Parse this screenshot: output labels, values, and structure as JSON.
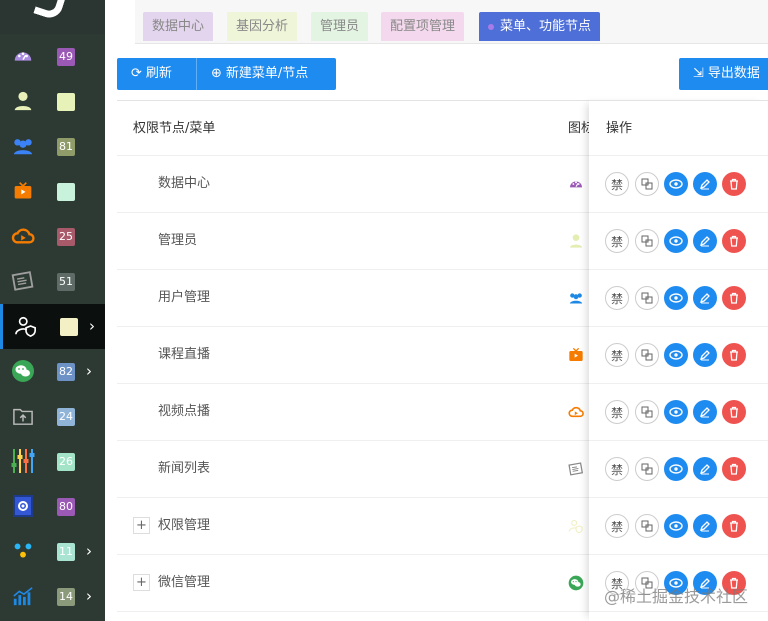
{
  "sidebar": {
    "items": [
      {
        "icon": "dashboard-icon",
        "badge": "49",
        "badge_color": "#9b59b6",
        "arrow": false,
        "active": false
      },
      {
        "icon": "user-icon",
        "badge": "",
        "badge_color": "#e7f2b8",
        "arrow": false,
        "active": false
      },
      {
        "icon": "users-group-icon",
        "badge": "81",
        "badge_color": "#8f9c6a",
        "arrow": false,
        "active": false
      },
      {
        "icon": "tv-icon",
        "badge": "",
        "badge_color": "#c8f2dc",
        "arrow": false,
        "active": false
      },
      {
        "icon": "cloud-video-icon",
        "badge": "25",
        "badge_color": "#a85a6b",
        "arrow": false,
        "active": false
      },
      {
        "icon": "newspaper-icon",
        "badge": "51",
        "badge_color": "#5f6b66",
        "arrow": false,
        "active": false
      },
      {
        "icon": "user-shield-icon",
        "badge": "",
        "badge_color": "#f2f0c4",
        "arrow": true,
        "active": true
      },
      {
        "icon": "wechat-icon",
        "badge": "82",
        "badge_color": "#6c92c6",
        "arrow": true,
        "active": false
      },
      {
        "icon": "folder-upload-icon",
        "badge": "24",
        "badge_color": "#90b4d8",
        "arrow": false,
        "active": false
      },
      {
        "icon": "sliders-icon",
        "badge": "26",
        "badge_color": "#a3e4c8",
        "arrow": false,
        "active": false
      },
      {
        "icon": "settings-book-icon",
        "badge": "80",
        "badge_color": "#9b59b6",
        "arrow": false,
        "active": false
      },
      {
        "icon": "network-icon",
        "badge": "11",
        "badge_color": "#a9e4d2",
        "arrow": true,
        "active": false
      },
      {
        "icon": "chart-icon",
        "badge": "14",
        "badge_color": "#8a9a7a",
        "arrow": true,
        "active": false
      }
    ]
  },
  "tabs": [
    {
      "label": "数据中心",
      "bg": "#e3d5ee",
      "active": false
    },
    {
      "label": "基因分析",
      "bg": "#eef5d9",
      "active": false
    },
    {
      "label": "管理员",
      "bg": "#e4f4e2",
      "active": false
    },
    {
      "label": "配置项管理",
      "bg": "#f4d9ee",
      "active": false
    },
    {
      "label": "菜单、功能节点",
      "bg": "#4e6fd8",
      "active": true
    }
  ],
  "toolbar": {
    "refresh_label": "刷新",
    "new_label": "新建菜单/节点",
    "export_label": "导出数据"
  },
  "table": {
    "col_name": "权限节点/菜单",
    "col_icon": "图标",
    "col_actions": "操作",
    "rows": [
      {
        "name": "数据中心",
        "icon": "dashboard-icon",
        "icon_color": "#9b59b6",
        "expandable": false
      },
      {
        "name": "管理员",
        "icon": "user-icon",
        "icon_color": "#e4eeb3",
        "expandable": false
      },
      {
        "name": "用户管理",
        "icon": "users-group-icon",
        "icon_color": "#1e88e5",
        "expandable": false
      },
      {
        "name": "课程直播",
        "icon": "tv-icon",
        "icon_color": "#f57c00",
        "expandable": false
      },
      {
        "name": "视频点播",
        "icon": "cloud-video-icon",
        "icon_color": "#f57c00",
        "expandable": false
      },
      {
        "name": "新闻列表",
        "icon": "newspaper-icon",
        "icon_color": "#888888",
        "expandable": false
      },
      {
        "name": "权限管理",
        "icon": "user-shield-icon",
        "icon_color": "#f2f0c4",
        "expandable": true
      },
      {
        "name": "微信管理",
        "icon": "wechat-icon",
        "icon_color": "#3aa757",
        "expandable": true
      }
    ],
    "action_disable_label": "禁"
  },
  "watermark": "@稀土掘金技术社区"
}
